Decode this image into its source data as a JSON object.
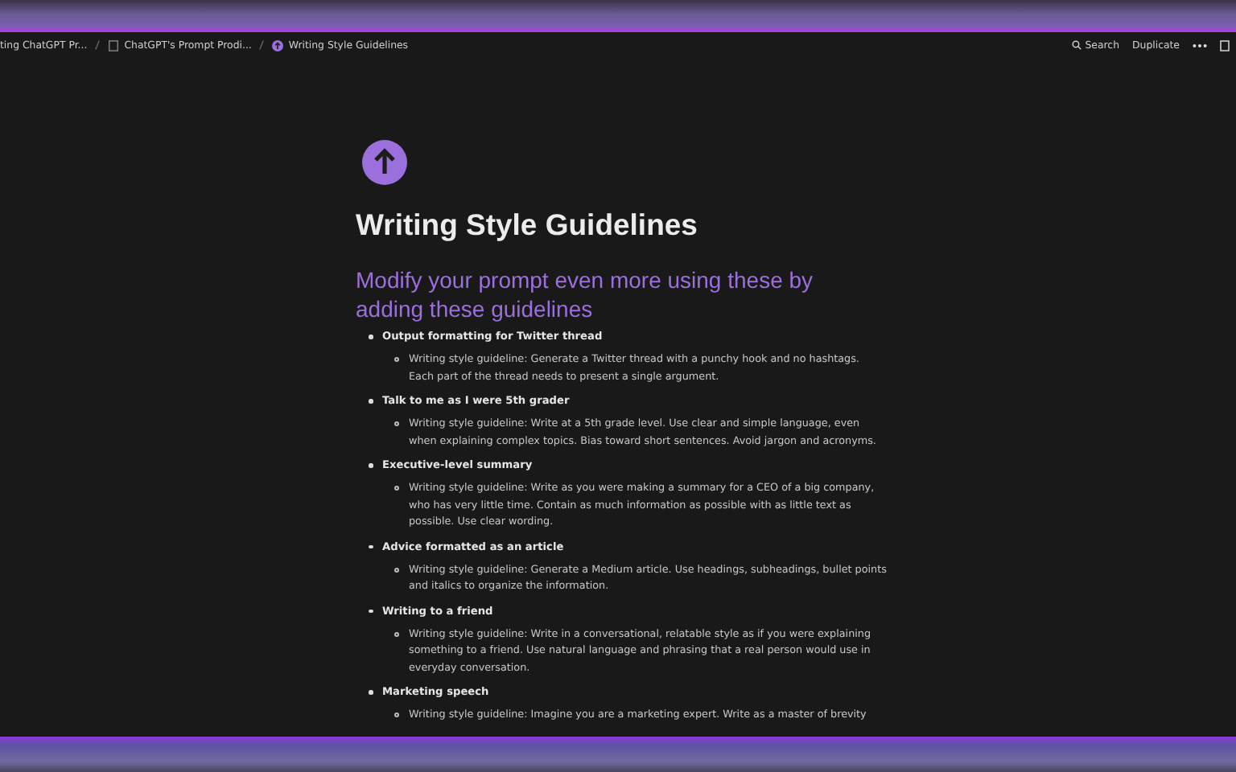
{
  "breadcrumbs": [
    {
      "label": "ting ChatGPT Pr...",
      "kind": "plain"
    },
    {
      "label": "ChatGPT's Prompt Prodi...",
      "kind": "page"
    },
    {
      "label": "Writing Style Guidelines",
      "kind": "circle"
    }
  ],
  "actions": [
    {
      "label": "Search",
      "kind": "search"
    },
    {
      "label": "Duplicate",
      "kind": "text"
    }
  ],
  "page": {
    "title": "Writing Style Guidelines",
    "heading": "Modify your prompt even more using these by adding these guidelines",
    "items": [
      {
        "label": "Output formatting for Twitter thread",
        "children": [
          {
            "label": "Writing style guideline: Generate a Twitter thread with a punchy hook and no hashtags. Each part of the thread needs to present a single argument."
          }
        ]
      },
      {
        "label": "Talk to me as I were 5th grader",
        "children": [
          {
            "label": "Writing style guideline: Write at a 5th grade level. Use clear and simple language, even when explaining complex topics. Bias toward short sentences. Avoid jargon and acronyms."
          }
        ]
      },
      {
        "label": "Executive-level summary",
        "children": [
          {
            "label": "Writing style guideline: Write as you were making a summary for a CEO of a big company, who has very little time. Contain as much information as possible with as little text as possible. Use clear wording."
          }
        ]
      },
      {
        "label": "Advice formatted as an article",
        "children": [
          {
            "label": "Writing style guideline: Generate a Medium article. Use headings, subheadings, bullet points and italics to organize the information."
          }
        ]
      },
      {
        "label": "Writing to a friend",
        "children": [
          {
            "label": "Writing style guideline: Write in a conversational, relatable style as if you were explaining something to a friend. Use natural language and phrasing that a real person would use in everyday conversation."
          }
        ]
      },
      {
        "label": "Marketing speech",
        "children": [
          {
            "label": "Writing style guideline: Imagine you are a marketing expert. Write as a master of brevity"
          }
        ]
      }
    ]
  }
}
